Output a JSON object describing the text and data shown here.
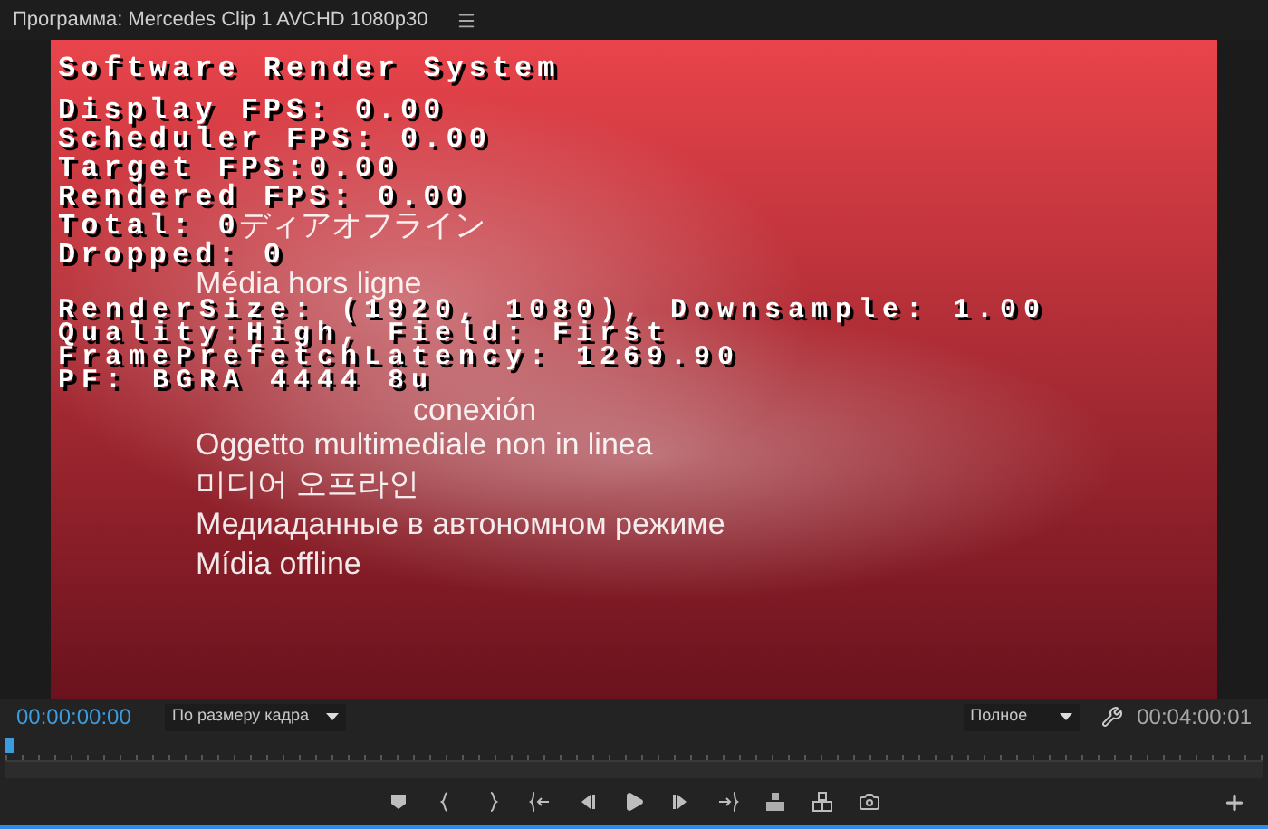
{
  "panel": {
    "title": "Программа: Mercedes Clip 1 AVCHD 1080p30"
  },
  "video": {
    "offline_messages": [
      "ディアオフライン",
      "Média hors ligne",
      "conexión",
      "Oggetto multimediale non in linea",
      "미디어 오프라인",
      "Медиаданные в автономном режиме",
      "Mídia offline"
    ],
    "stats_title": "Software Render System",
    "stats_block_1": [
      "Display FPS: 0.00",
      "Scheduler FPS: 0.00",
      "Target FPS:0.00",
      "Rendered FPS: 0.00",
      "Total: 0",
      "Dropped: 0"
    ],
    "stats_block_2": [
      "RenderSize: (1920, 1080), Downsample: 1.00",
      "Quality:High, Field: First",
      "FramePrefetchLatency: 1269.90",
      "PF: BGRA 4444 8u"
    ]
  },
  "controls": {
    "current_time": "00:00:00:00",
    "zoom": "По размеру кадра",
    "quality": "Полное",
    "duration": "00:04:00:01",
    "playhead": {
      "level": 0
    }
  }
}
